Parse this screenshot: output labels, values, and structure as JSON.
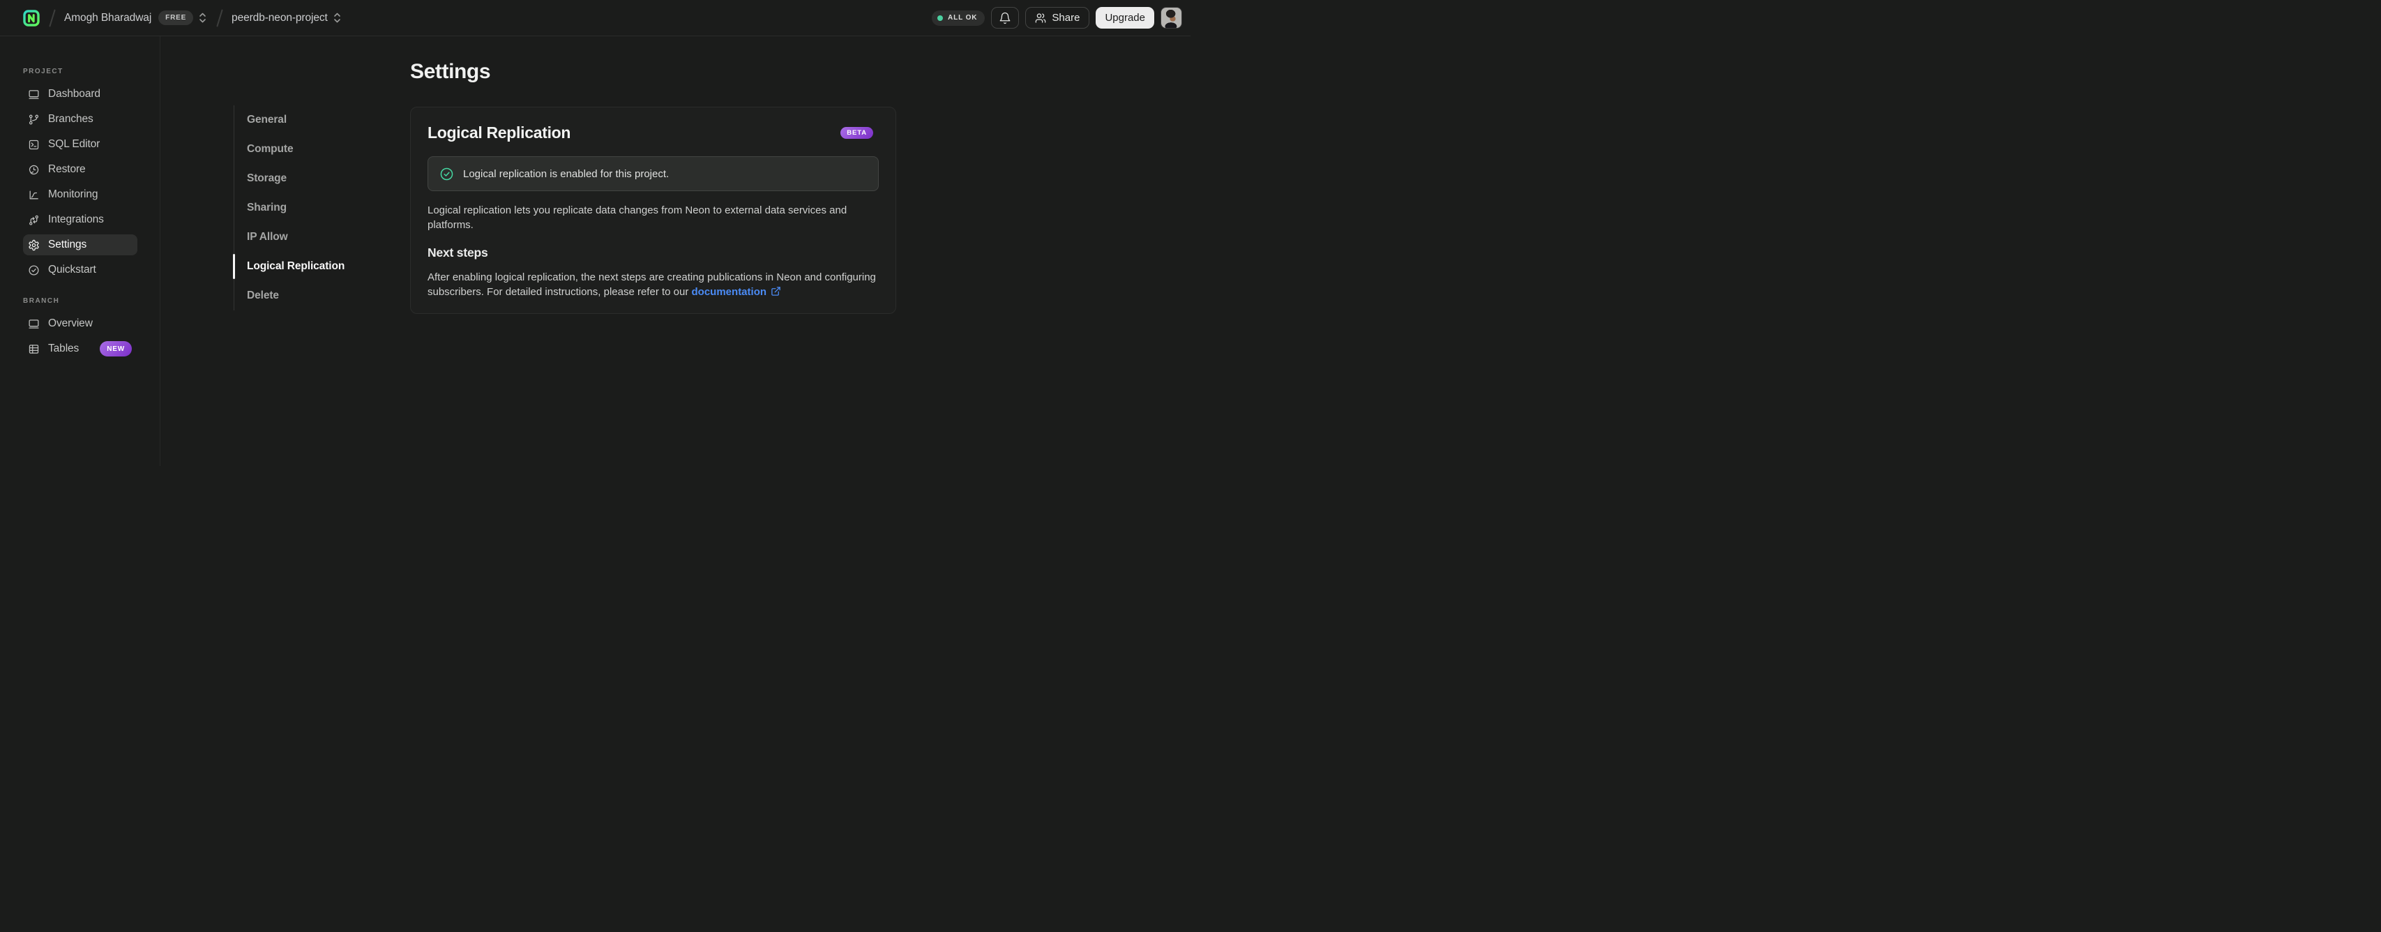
{
  "header": {
    "org_name": "Amogh Bharadwaj",
    "org_badge": "FREE",
    "project_name": "peerdb-neon-project",
    "status_label": "ALL OK",
    "share_label": "Share",
    "upgrade_label": "Upgrade"
  },
  "sidebar": {
    "project_label": "PROJECT",
    "project_items": [
      {
        "label": "Dashboard",
        "icon": "dashboard-icon"
      },
      {
        "label": "Branches",
        "icon": "branches-icon"
      },
      {
        "label": "SQL Editor",
        "icon": "sql-editor-icon"
      },
      {
        "label": "Restore",
        "icon": "restore-icon"
      },
      {
        "label": "Monitoring",
        "icon": "monitoring-icon"
      },
      {
        "label": "Integrations",
        "icon": "integrations-icon"
      },
      {
        "label": "Settings",
        "icon": "settings-icon",
        "active": true
      },
      {
        "label": "Quickstart",
        "icon": "quickstart-icon"
      }
    ],
    "branch_label": "BRANCH",
    "branch_items": [
      {
        "label": "Overview",
        "icon": "overview-icon"
      },
      {
        "label": "Tables",
        "icon": "tables-icon",
        "badge": "NEW"
      }
    ]
  },
  "settings_nav": {
    "items": [
      {
        "label": "General"
      },
      {
        "label": "Compute"
      },
      {
        "label": "Storage"
      },
      {
        "label": "Sharing"
      },
      {
        "label": "IP Allow"
      },
      {
        "label": "Logical Replication",
        "active": true
      },
      {
        "label": "Delete"
      }
    ]
  },
  "main": {
    "title": "Settings",
    "card": {
      "title": "Logical Replication",
      "badge": "BETA",
      "alert_text": "Logical replication is enabled for this project.",
      "description_line1": "Logical replication lets you replicate data changes from Neon to external data services and",
      "description_line2": "platforms.",
      "next_steps_title": "Next steps",
      "next_steps_line1": "After enabling logical replication, the next steps are creating publications in Neon and configuring",
      "next_steps_line2_prefix": "subscribers. For detailed instructions, please refer to our ",
      "doc_link_label": "documentation"
    }
  },
  "colors": {
    "status_green": "#4bd0a0",
    "badge_purple_start": "#a96de6",
    "badge_purple_end": "#7c2fc8",
    "link_blue": "#4b8bf5"
  }
}
